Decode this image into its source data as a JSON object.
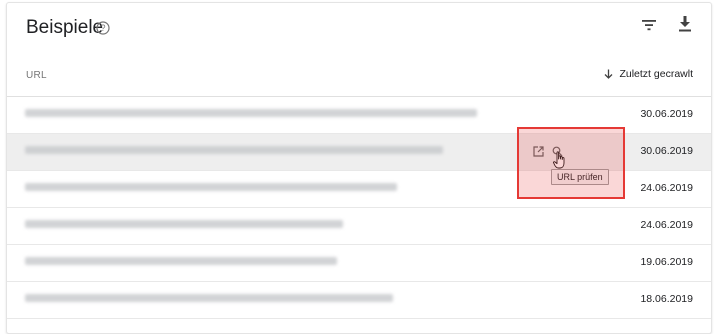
{
  "card": {
    "title": "Beispiele",
    "icons": {
      "help": "help-circle-icon",
      "filter": "filter-icon",
      "download": "download-icon"
    }
  },
  "table": {
    "columns": {
      "url": "URL",
      "date": "Zuletzt gecrawlt",
      "sort_icon": "arrow-down-icon"
    },
    "rows": [
      {
        "url": "",
        "date": "30.06.2019"
      },
      {
        "url": "",
        "date": "30.06.2019"
      },
      {
        "url": "",
        "date": "24.06.2019"
      },
      {
        "url": "",
        "date": "24.06.2019"
      },
      {
        "url": "",
        "date": "19.06.2019"
      },
      {
        "url": "",
        "date": "18.06.2019"
      }
    ],
    "hover_row": {
      "icons": {
        "open": "open-in-new-icon",
        "inspect": "inspect-url-icon"
      },
      "tooltip": "URL prüfen"
    }
  },
  "colors": {
    "highlight": "#e53935",
    "hover_row": "#eeeeee",
    "blurred_url": "#c9cbce"
  }
}
